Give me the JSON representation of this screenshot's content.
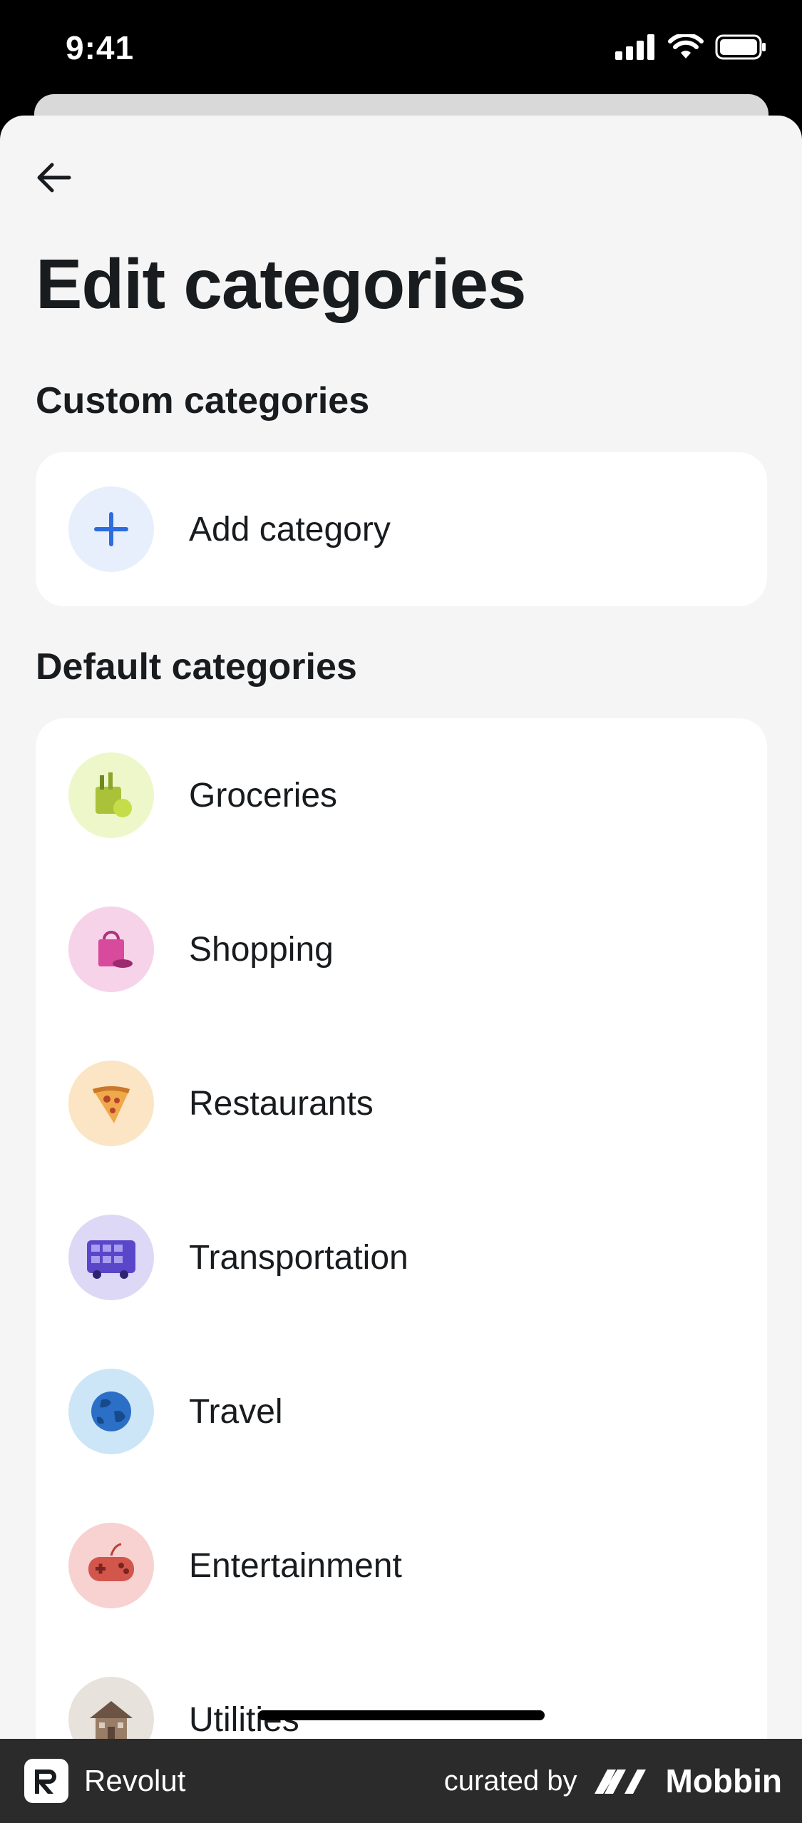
{
  "status_bar": {
    "time": "9:41"
  },
  "header": {
    "title": "Edit categories"
  },
  "custom_section": {
    "title": "Custom categories",
    "add_label": "Add category"
  },
  "default_section": {
    "title": "Default categories",
    "items": [
      {
        "label": "Groceries",
        "icon": "groceries-bag-icon",
        "bg": "#eef7c9"
      },
      {
        "label": "Shopping",
        "icon": "shopping-bag-icon",
        "bg": "#f6d3e8"
      },
      {
        "label": "Restaurants",
        "icon": "pizza-slice-icon",
        "bg": "#fbe5c4"
      },
      {
        "label": "Transportation",
        "icon": "bus-icon",
        "bg": "#ddd8f5"
      },
      {
        "label": "Travel",
        "icon": "globe-icon",
        "bg": "#cde6f7"
      },
      {
        "label": "Entertainment",
        "icon": "gamepad-icon",
        "bg": "#f7d2d0"
      },
      {
        "label": "Utilities",
        "icon": "house-icon",
        "bg": "#e8e2dc"
      }
    ]
  },
  "footer": {
    "brand": "Revolut",
    "curated_by": "curated by",
    "curator": "Mobbin"
  },
  "colors": {
    "accent": "#2d6cdf",
    "add_bg": "#e7effc",
    "sheet_bg": "#f5f5f6"
  }
}
